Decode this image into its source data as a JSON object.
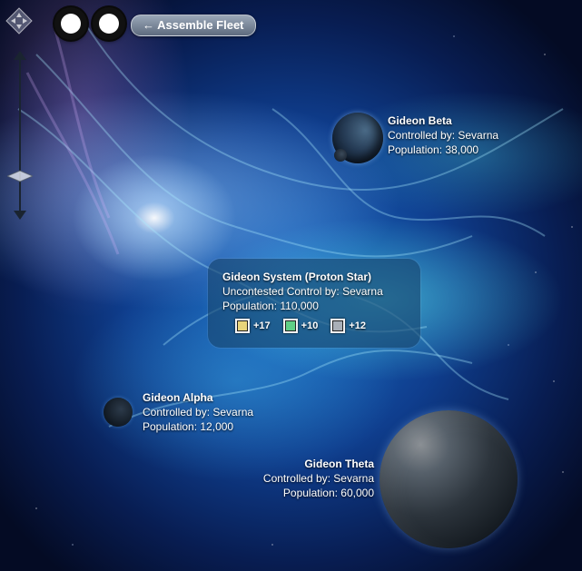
{
  "toolbar": {
    "assemble_fleet_label": "← Assemble Fleet"
  },
  "system": {
    "name": "Gideon System (Proton Star)",
    "control": "Uncontested Control by: Sevarna",
    "population": "Population: 110,000",
    "resources": [
      {
        "icon": "yellow-resource-icon",
        "color": "#e8d47a",
        "value": "+17"
      },
      {
        "icon": "green-resource-icon",
        "color": "#5fcf86",
        "value": "+10"
      },
      {
        "icon": "gray-resource-icon",
        "color": "#a9b0b8",
        "value": "+12"
      }
    ]
  },
  "planets": {
    "beta": {
      "name": "Gideon Beta",
      "control": "Controlled by: Sevarna",
      "population": "Population: 38,000"
    },
    "alpha": {
      "name": "Gideon Alpha",
      "control": "Controlled by: Sevarna",
      "population": "Population: 12,000"
    },
    "theta": {
      "name": "Gideon Theta",
      "control": "Controlled by: Sevarna",
      "population": "Population: 60,000"
    }
  }
}
